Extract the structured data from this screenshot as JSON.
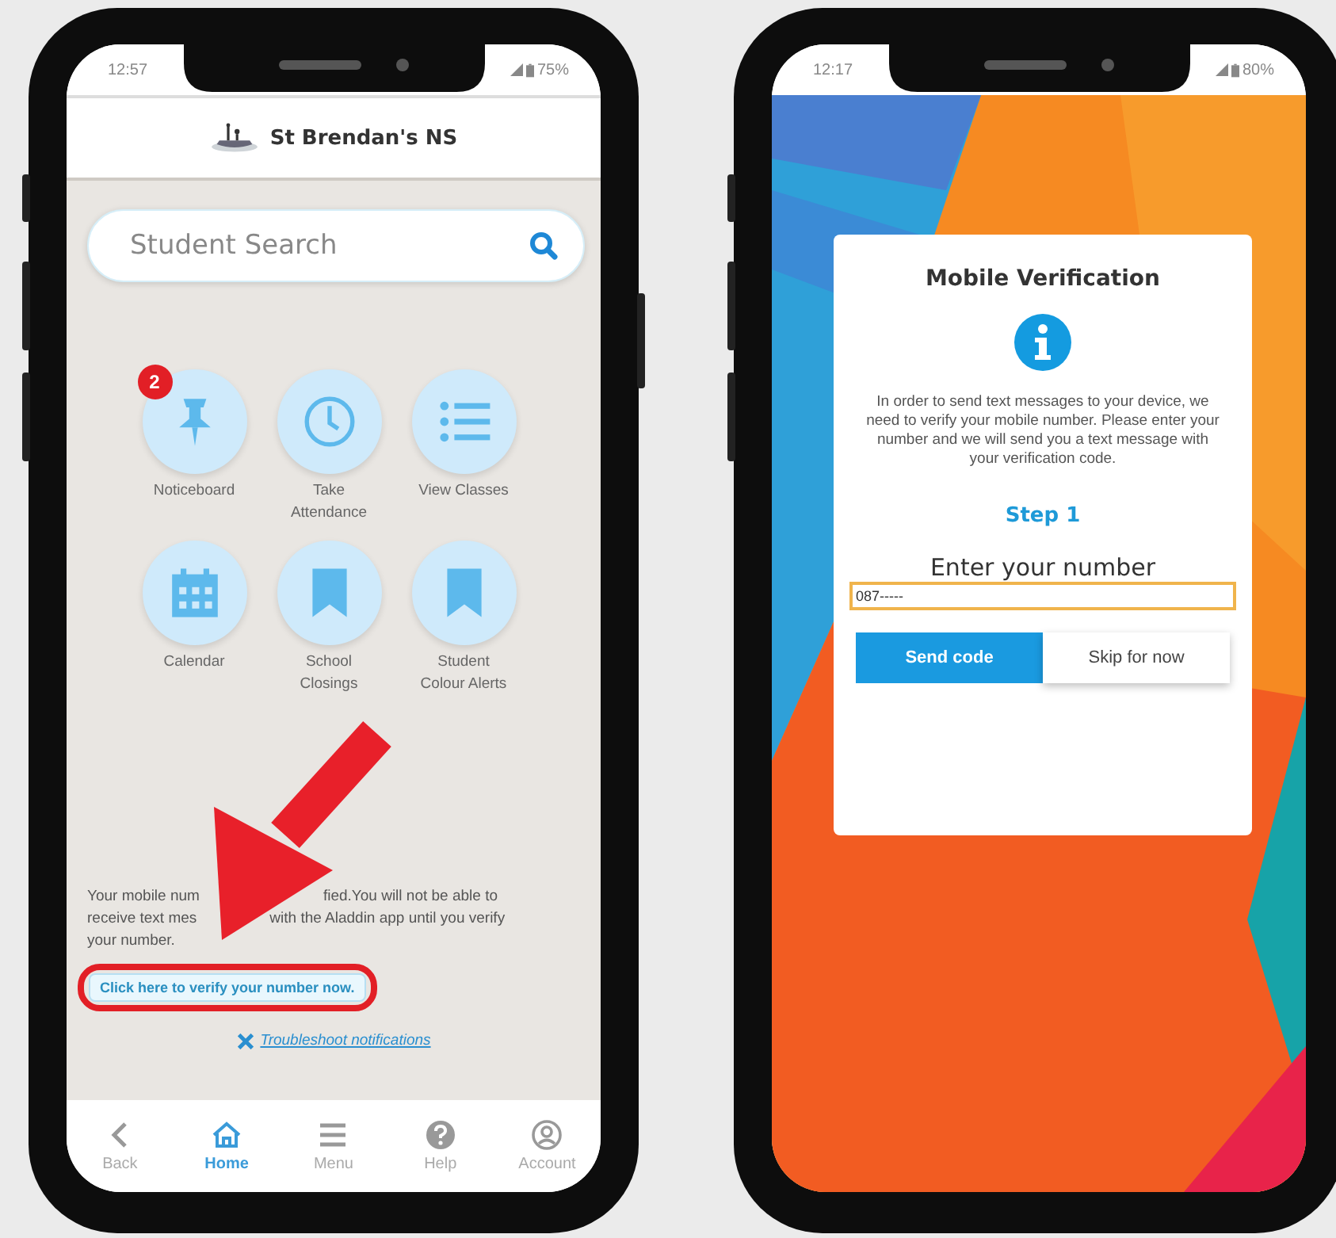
{
  "home_screen": {
    "status_bar": {
      "time": "12:57",
      "battery": "75%"
    },
    "header": {
      "title": "St Brendan's NS"
    },
    "search": {
      "placeholder": "Student Search"
    },
    "tiles": [
      {
        "kind": "pin",
        "label": "Noticeboard",
        "badge": "2"
      },
      {
        "kind": "clock",
        "label": "Take Attendance"
      },
      {
        "kind": "list",
        "label": "View Classes"
      },
      {
        "kind": "calendar",
        "label": "Calendar"
      },
      {
        "kind": "bookmark",
        "label": "School Closings"
      },
      {
        "kind": "bookmark",
        "label": "Student Colour Alerts"
      }
    ],
    "notice_lines": [
      {
        "before": "Your mobile num",
        "after": "fied.You will not be able to"
      },
      {
        "before": "receive text mes",
        "after": "with the Aladdin app until you verify"
      },
      {
        "before": "your number."
      }
    ],
    "verify_button": {
      "label": "Click here to verify your number now."
    },
    "troubleshoot_link": {
      "label": "Troubleshoot notifications"
    },
    "nav": [
      {
        "kind": "back",
        "label": "Back",
        "selected": false
      },
      {
        "kind": "home",
        "label": "Home",
        "selected": true
      },
      {
        "kind": "menu",
        "label": "Menu",
        "selected": false
      },
      {
        "kind": "help",
        "label": "Help",
        "selected": false
      },
      {
        "kind": "account",
        "label": "Account",
        "selected": false
      }
    ]
  },
  "verification_screen": {
    "status_bar": {
      "time": "12:17",
      "battery": "80%"
    },
    "dialog": {
      "title": "Mobile Verification",
      "message": "In order to send text messages to your device, we need to verify your mobile number. Please enter your number and we will send you a text message with your verification code.",
      "step": "Step 1",
      "field_label": "Enter your number",
      "field_value": "087-----",
      "field_focused": true,
      "buttons": [
        {
          "kind": "primary",
          "label": "Send code"
        },
        {
          "kind": "secondary",
          "label": "Skip for now"
        }
      ]
    }
  }
}
